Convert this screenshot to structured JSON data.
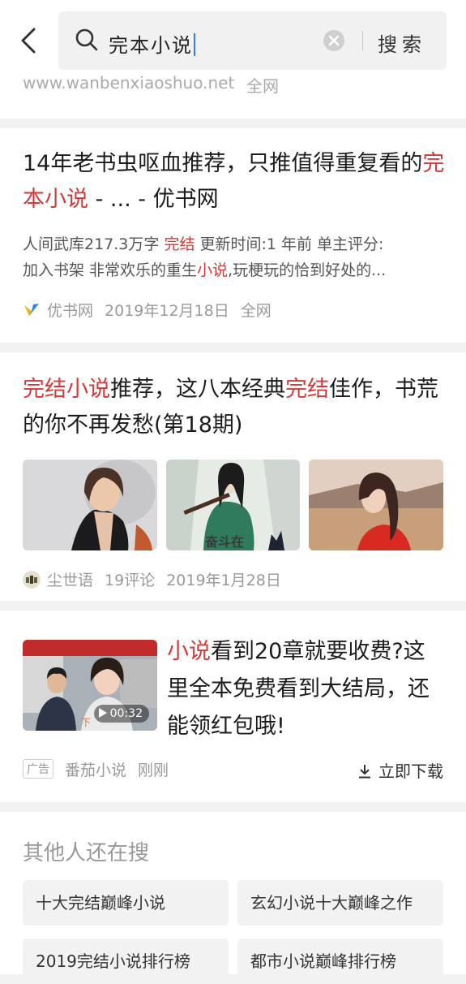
{
  "search": {
    "query": "完本小说",
    "button_label": "搜索"
  },
  "site_line": {
    "url": "www.wanbenxiaoshuo.net",
    "tag": "全网"
  },
  "result1": {
    "title_a": "14年老书虫呕血推荐，只推值得重复看的",
    "title_hl": "完本小说",
    "title_b": " - ... - 优书网",
    "snippet1_a": "人间武库217.3万字 ",
    "snippet1_hl": "完结",
    "snippet1_b": " 更新时间:1 年前 单主评分:",
    "snippet2_a": "加入书架 非常欢乐的重生",
    "snippet2_hl": "小说",
    "snippet2_b": ",玩梗玩的恰到好处的...",
    "source": "优书网",
    "date": "2019年12月18日",
    "scope": "全网"
  },
  "result2": {
    "title_hl1": "完结小说",
    "title_a": "推荐，这八本经典",
    "title_hl2": "完结",
    "title_b": "佳作，书荒的你不再发愁(第18期)",
    "image2_caption": "奋斗在",
    "source": "尘世语",
    "comments": "19评论",
    "date": "2019年1月28日"
  },
  "ad": {
    "title_hl": "小说",
    "title_a": "看到20章就要收费?这里全本免费看到大结局，还能领红包哦!",
    "video_duration": "00:32",
    "ad_label": "广告",
    "source": "番茄小说",
    "time": "刚刚",
    "download_label": "立即下载"
  },
  "related": {
    "heading": "其他人还在搜",
    "items": [
      "十大完结巅峰小说",
      "玄幻小说十大巅峰之作",
      "2019完结小说排行榜",
      "都市小说巅峰排行榜"
    ]
  },
  "colors": {
    "highlight": "#d33a3a",
    "caret": "#3478f6"
  }
}
